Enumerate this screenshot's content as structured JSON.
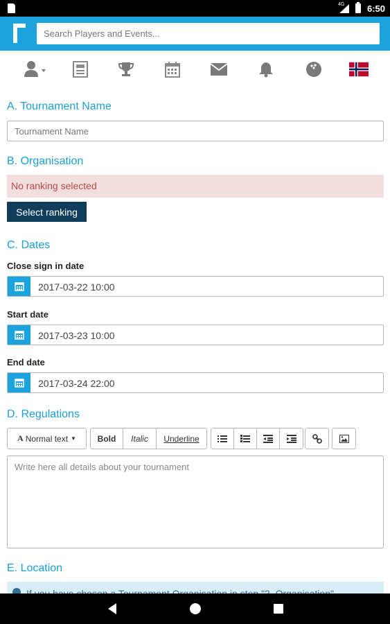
{
  "status_bar": {
    "time": "6:50",
    "network": "4G"
  },
  "header": {
    "search_placeholder": "Search Players and Events..."
  },
  "nav_icons": [
    "user-icon",
    "news-icon",
    "trophy-icon",
    "calendar-icon",
    "mail-icon",
    "bell-icon",
    "ball-icon",
    "norway-flag-icon"
  ],
  "form": {
    "tournament_name": {
      "title": "A. Tournament Name",
      "placeholder": "Tournament Name"
    },
    "organisation": {
      "title": "B. Organisation",
      "alert": "No ranking selected",
      "button": "Select ranking"
    },
    "dates": {
      "title": "C. Dates",
      "close_label": "Close sign in date",
      "close_value": "2017-03-22 10:00",
      "start_label": "Start date",
      "start_value": "2017-03-23 10:00",
      "end_label": "End date",
      "end_value": "2017-03-24 22:00"
    },
    "regulations": {
      "title": "D. Regulations",
      "format_label": "Normal text",
      "bold": "Bold",
      "italic": "Italic",
      "underline": "Underline",
      "editor_placeholder": "Write here all details about your tournament"
    },
    "location": {
      "title": "E. Location",
      "info": "If you have chosen a Tournament Organisation in step \"2. Organisation\""
    }
  },
  "colors": {
    "brand": "#1ca3dd",
    "button_dark": "#0f3d5a",
    "alert_bg": "#f2dede",
    "alert_text": "#b94a48"
  }
}
